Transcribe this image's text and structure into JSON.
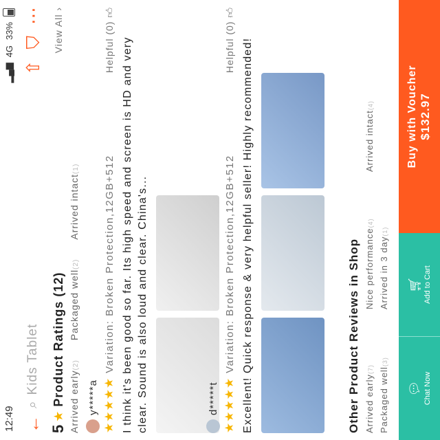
{
  "status": {
    "time": "12:49",
    "battery": "33%",
    "signal": "4G"
  },
  "search": {
    "query": "Kids Tablet"
  },
  "ratings": {
    "score": "5",
    "title": "Product Ratings (12)",
    "view_all": "View All",
    "tags": [
      {
        "label": "Arrived early",
        "count": "(2)"
      },
      {
        "label": "Packaged well",
        "count": "(2)"
      },
      {
        "label": "Arrived intact",
        "count": "(1)"
      }
    ]
  },
  "reviews": [
    {
      "user": "y*****a",
      "stars": "★★★★★",
      "variation": "Variation: Broken Protection,12GB+512",
      "helpful": "Helpful (0)",
      "text": "I think it's been good so far. Its high speed and screen is HD and very clear. Sound is also loud and clear. China's...",
      "photos": [
        "#ececec",
        "#e6e6e6"
      ]
    },
    {
      "user": "d*****t",
      "stars": "★★★★★",
      "variation": "Variation: Broken Protection,12GB+512",
      "helpful": "Helpful (0)",
      "text": "Excellent! Quick response & very helpful seller! Highly recommended!",
      "photos": [
        "#8fb2d8",
        "#cfd8e0",
        "#9dbbe0"
      ]
    }
  ],
  "shop": {
    "title": "Other Product Reviews in Shop",
    "tags": [
      {
        "label": "Arrived early",
        "count": "(7)"
      },
      {
        "label": "Nice performance",
        "count": "(4)"
      },
      {
        "label": "Arrived intact",
        "count": "(4)"
      },
      {
        "label": "Packaged well",
        "count": "(3)"
      },
      {
        "label": "Arrived in 3 day",
        "count": "(1)"
      }
    ]
  },
  "bottom": {
    "chat": "Chat Now",
    "cart": "Add to Cart",
    "buy": "Buy with Voucher",
    "price": "$132.97"
  },
  "colors": {
    "accent": "#ff5a1f",
    "teal": "#2bbfa4",
    "star": "#f7b500"
  }
}
